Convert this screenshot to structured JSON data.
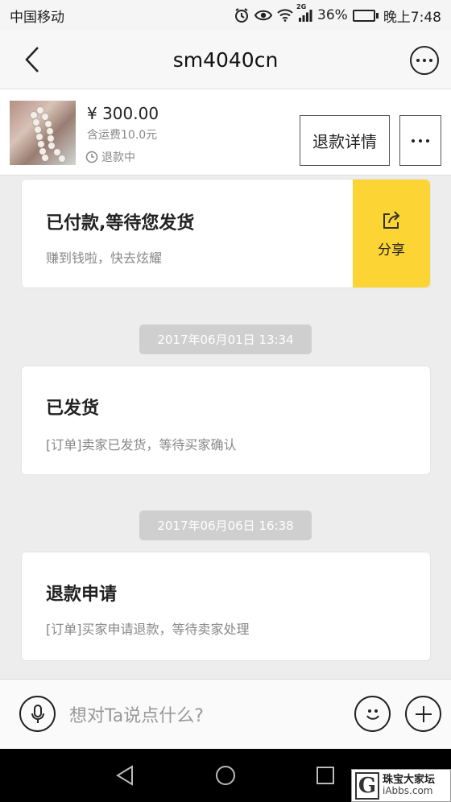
{
  "status_bar": {
    "carrier": "中国移动",
    "network": "2G",
    "battery": "36%",
    "battery_level": 0.36,
    "time": "晚上7:48",
    "icons": [
      "alarm-icon",
      "eye-icon",
      "wifi-icon",
      "signal-icon",
      "battery-icon"
    ]
  },
  "nav": {
    "title": "sm4040cn",
    "icons": [
      "back-arrow-icon",
      "more-circle-icon"
    ]
  },
  "product": {
    "price": "¥ 300.00",
    "shipping": "含运费10.0元",
    "status": "退款中",
    "refund_button": "退款详情",
    "icons": [
      "clock-icon",
      "more-dots-icon"
    ]
  },
  "messages": [
    {
      "title": "已付款,等待您发货",
      "subtitle": "赚到钱啦，快去炫耀",
      "share_label": "分享"
    },
    {
      "time": "2017年06月01日 13:34",
      "title": "已发货",
      "subtitle": "[订单]卖家已发货，等待买家确认"
    },
    {
      "time": "2017年06月06日 16:38",
      "title": "退款申请",
      "subtitle": "[订单]买家申请退款，等待卖家处理"
    }
  ],
  "input": {
    "placeholder": "想对Ta说点什么?",
    "icons": [
      "microphone-icon",
      "emoji-icon",
      "plus-icon"
    ]
  },
  "watermark": {
    "letter": "G",
    "line1": "珠宝大家坛",
    "line2": "iAbbs.com"
  },
  "colors": {
    "accent_yellow": "#fcd535",
    "background": "#ededed",
    "timestamp_bg": "#cfcfcf"
  }
}
